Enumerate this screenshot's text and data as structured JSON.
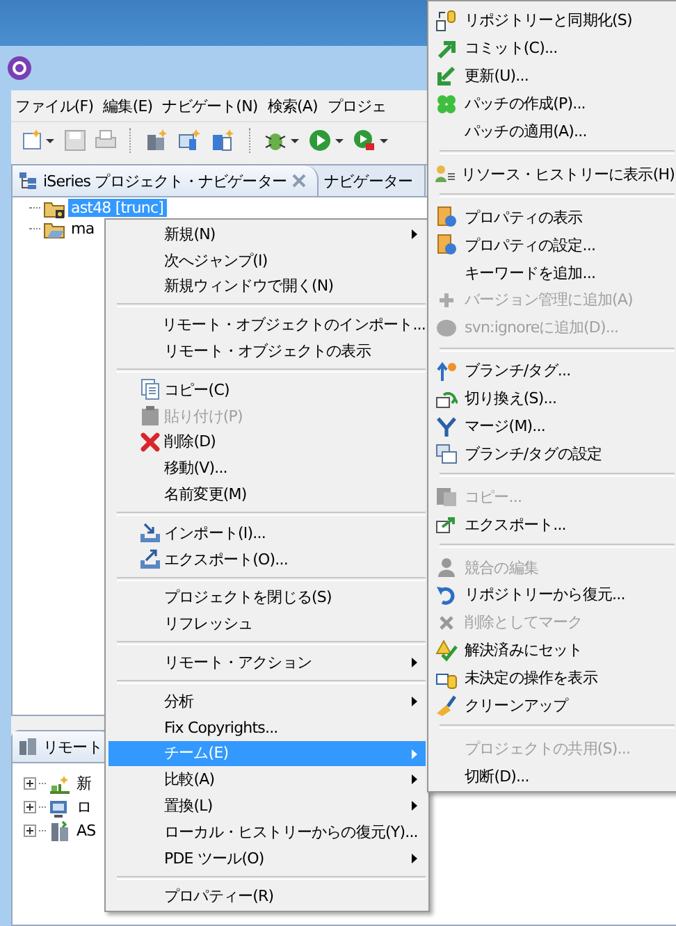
{
  "menu_bar": [
    {
      "label": "ファイル(F)"
    },
    {
      "label": "編集(E)"
    },
    {
      "label": "ナビゲート(N)"
    },
    {
      "label": "検索(A)"
    },
    {
      "label": "プロジェ"
    }
  ],
  "navigator": {
    "tabs": [
      {
        "label": "iSeries プロジェクト・ナビゲーター",
        "selected": true,
        "closable": true
      },
      {
        "label": "ナビゲーター",
        "selected": false,
        "closable": false
      }
    ],
    "tree": [
      {
        "label": "ast48 [trunc]",
        "selected": true
      },
      {
        "label": "ma",
        "selected": false
      }
    ]
  },
  "remote_view": {
    "tab": "リモート",
    "tree": [
      {
        "label": "新"
      },
      {
        "label": "ロ"
      },
      {
        "label": "AS"
      }
    ]
  },
  "context_menu": {
    "items": [
      {
        "kind": "item",
        "label": "新規(N)",
        "submenu": true,
        "disabled": false,
        "selected": false
      },
      {
        "kind": "item",
        "label": "次へジャンプ(I)",
        "submenu": false,
        "disabled": false,
        "selected": false
      },
      {
        "kind": "item",
        "label": "新規ウィンドウで開く(N)",
        "submenu": false,
        "disabled": false,
        "selected": false
      },
      {
        "kind": "separator"
      },
      {
        "kind": "item",
        "label": "リモート・オブジェクトのインポート...",
        "submenu": false,
        "disabled": false,
        "selected": false
      },
      {
        "kind": "item",
        "label": "リモート・オブジェクトの表示",
        "submenu": false,
        "disabled": false,
        "selected": false
      },
      {
        "kind": "separator"
      },
      {
        "kind": "item",
        "label": "コピー(C)",
        "submenu": false,
        "disabled": false,
        "selected": false
      },
      {
        "kind": "item",
        "label": "貼り付け(P)",
        "submenu": false,
        "disabled": true,
        "selected": false
      },
      {
        "kind": "item",
        "label": "削除(D)",
        "submenu": false,
        "disabled": false,
        "selected": false
      },
      {
        "kind": "item",
        "label": "移動(V)...",
        "submenu": false,
        "disabled": false,
        "selected": false
      },
      {
        "kind": "item",
        "label": "名前変更(M)",
        "submenu": false,
        "disabled": false,
        "selected": false
      },
      {
        "kind": "separator"
      },
      {
        "kind": "item",
        "label": "インポート(I)...",
        "submenu": false,
        "disabled": false,
        "selected": false
      },
      {
        "kind": "item",
        "label": "エクスポート(O)...",
        "submenu": false,
        "disabled": false,
        "selected": false
      },
      {
        "kind": "separator"
      },
      {
        "kind": "item",
        "label": "プロジェクトを閉じる(S)",
        "submenu": false,
        "disabled": false,
        "selected": false
      },
      {
        "kind": "item",
        "label": "リフレッシュ",
        "submenu": false,
        "disabled": false,
        "selected": false
      },
      {
        "kind": "separator"
      },
      {
        "kind": "item",
        "label": "リモート・アクション",
        "submenu": true,
        "disabled": false,
        "selected": false
      },
      {
        "kind": "separator"
      },
      {
        "kind": "item",
        "label": "分析",
        "submenu": true,
        "disabled": false,
        "selected": false
      },
      {
        "kind": "item",
        "label": "Fix Copyrights...",
        "submenu": false,
        "disabled": false,
        "selected": false
      },
      {
        "kind": "item",
        "label": "チーム(E)",
        "submenu": true,
        "disabled": false,
        "selected": true
      },
      {
        "kind": "item",
        "label": "比較(A)",
        "submenu": true,
        "disabled": false,
        "selected": false
      },
      {
        "kind": "item",
        "label": "置換(L)",
        "submenu": true,
        "disabled": false,
        "selected": false
      },
      {
        "kind": "item",
        "label": "ローカル・ヒストリーからの復元(Y)...",
        "submenu": false,
        "disabled": false,
        "selected": false
      },
      {
        "kind": "item",
        "label": "PDE ツール(O)",
        "submenu": true,
        "disabled": false,
        "selected": false
      },
      {
        "kind": "separator"
      },
      {
        "kind": "item",
        "label": "プロパティー(R)",
        "submenu": false,
        "disabled": false,
        "selected": false
      }
    ]
  },
  "team_submenu": {
    "items": [
      {
        "kind": "item",
        "label": "リポジトリーと同期化(S)",
        "disabled": false,
        "selected": false
      },
      {
        "kind": "item",
        "label": "コミット(C)...",
        "disabled": false,
        "selected": false
      },
      {
        "kind": "item",
        "label": "更新(U)...",
        "disabled": false,
        "selected": false
      },
      {
        "kind": "item",
        "label": "パッチの作成(P)...",
        "disabled": false,
        "selected": false
      },
      {
        "kind": "item",
        "label": "パッチの適用(A)...",
        "disabled": false,
        "selected": false
      },
      {
        "kind": "separator"
      },
      {
        "kind": "item",
        "label": "リソース・ヒストリーに表示(H)",
        "disabled": false,
        "selected": false
      },
      {
        "kind": "separator"
      },
      {
        "kind": "item",
        "label": "プロパティの表示",
        "disabled": false,
        "selected": false
      },
      {
        "kind": "item",
        "label": "プロパティの設定...",
        "disabled": false,
        "selected": false
      },
      {
        "kind": "item",
        "label": "キーワードを追加...",
        "disabled": false,
        "selected": false
      },
      {
        "kind": "item",
        "label": "バージョン管理に追加(A)",
        "disabled": true,
        "selected": false
      },
      {
        "kind": "item",
        "label": "svn:ignoreに追加(D)...",
        "disabled": true,
        "selected": false
      },
      {
        "kind": "separator"
      },
      {
        "kind": "item",
        "label": "ブランチ/タグ...",
        "disabled": false,
        "selected": false
      },
      {
        "kind": "item",
        "label": "切り換え(S)...",
        "disabled": false,
        "selected": false
      },
      {
        "kind": "item",
        "label": "マージ(M)...",
        "disabled": false,
        "selected": false
      },
      {
        "kind": "item",
        "label": "ブランチ/タグの設定",
        "disabled": false,
        "selected": false
      },
      {
        "kind": "separator"
      },
      {
        "kind": "item",
        "label": "コピー...",
        "disabled": true,
        "selected": false
      },
      {
        "kind": "item",
        "label": "エクスポート...",
        "disabled": false,
        "selected": false
      },
      {
        "kind": "separator"
      },
      {
        "kind": "item",
        "label": "競合の編集",
        "disabled": true,
        "selected": false
      },
      {
        "kind": "item",
        "label": "リポジトリーから復元...",
        "disabled": false,
        "selected": false
      },
      {
        "kind": "item",
        "label": "削除としてマーク",
        "disabled": true,
        "selected": false
      },
      {
        "kind": "item",
        "label": "解決済みにセット",
        "disabled": false,
        "selected": false
      },
      {
        "kind": "item",
        "label": "未決定の操作を表示",
        "disabled": false,
        "selected": false
      },
      {
        "kind": "item",
        "label": "クリーンアップ",
        "disabled": false,
        "selected": false
      },
      {
        "kind": "separator"
      },
      {
        "kind": "item",
        "label": "プロジェクトの共用(S)...",
        "disabled": true,
        "selected": false
      },
      {
        "kind": "item",
        "label": "切断(D)...",
        "disabled": false,
        "selected": false
      }
    ]
  }
}
